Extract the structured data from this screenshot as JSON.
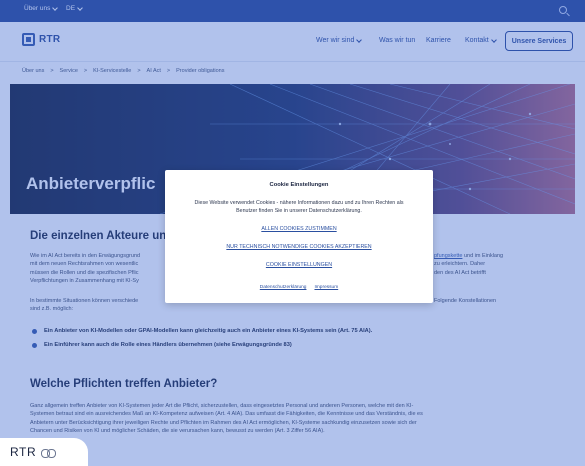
{
  "topbar": {
    "about_label": "Über uns",
    "language_label": "DE"
  },
  "header": {
    "logo_text": "RTR",
    "nav": [
      {
        "label": "Wer wir sind"
      },
      {
        "label": "Was wir tun"
      },
      {
        "label": "Karriere"
      },
      {
        "label": "Kontakt"
      }
    ],
    "services_button": "Unsere Services"
  },
  "breadcrumb": [
    "Über uns",
    ">",
    "Service",
    ">",
    "KI-Servicestelle",
    ">",
    "AI Act",
    ">",
    "Provider obligations"
  ],
  "hero": {
    "title": "Anbieterverpflic"
  },
  "section1": {
    "heading": "Die einzelnen Akteure un",
    "para1_lines": [
      "Wie im AI Act bereits in den Erwägungsgrund",
      "mit dem neuen Rechtsrahmen von wesentlic",
      "müssen die Rollen und die spezifischen Pflic",
      "Verpflichtungen in Zusammenhang mit KI-Sy"
    ],
    "para1_right_lines": [
      "pfungskette",
      " und im Einklang",
      "zu erleichtern. Daher",
      "den des AI Act betrifft"
    ],
    "para2_left": "In bestimmte Situationen können verschiede",
    "para2_right": "Folgende Konstellationen",
    "para2_line2": "sind z.B. möglich:",
    "bullets": [
      "Ein Anbieter von KI-Modellen oder GPAI-Modellen kann gleichzeitig auch ein Anbieter eines KI-Systems sein (Art. 75 AIA).",
      "Ein Einführer kann auch die Rolle eines Händlers übernehmen (siehe Erwägungsgründe 83)"
    ]
  },
  "section2": {
    "heading": "Welche Pflichten treffen Anbieter?",
    "lines": [
      "Ganz allgemein treffen Anbieter von KI-Systemen jeder Art die Pflicht, sicherzustellen, dass eingesetztes Personal und anderen Personen, welche mit den KI-",
      "Systemen betraut sind ein ausreichendes Maß an KI-Kompetenz aufweisen (Art. 4 AIA). Das umfasst die Fähigkeiten, die Kenntnisse und das Verständnis, die es",
      "Anbietern unter Berücksichtigung ihrer jeweiligen Rechte und Pflichten im Rahmen des AI Act ermöglichen, KI-Systeme sachkundig einzusetzen sowie sich der",
      "Chancen und Risiken von KI und möglicher Schäden, die sie verursachen kann, bewusst zu werden (Art. 3 Ziffer 56 AIA)."
    ]
  },
  "cookie": {
    "title": "Cookie Einstellungen",
    "text": "Diese Website verwendet Cookies - nähere Informationen dazu und zu Ihren Rechten als Benutzer finden Sie in unserer Datenschutzerklärung.",
    "accept_all": "ALLEN COOKIES ZUSTIMMEN",
    "accept_necessary": "NUR TECHNISCH NOTWENDIGE COOKIES AKZEPTIEREN",
    "settings": "COOKIE EINSTELLUNGEN",
    "privacy": "Datenschutzerklärung",
    "imprint": "Impressum"
  },
  "badge": {
    "text": "RTR",
    "icon": "link-icon"
  },
  "colors": {
    "brand_blue": "#1e3f8f",
    "link_blue": "#2a4fa0",
    "overlay": "rgba(70,110,210,0.42)"
  }
}
